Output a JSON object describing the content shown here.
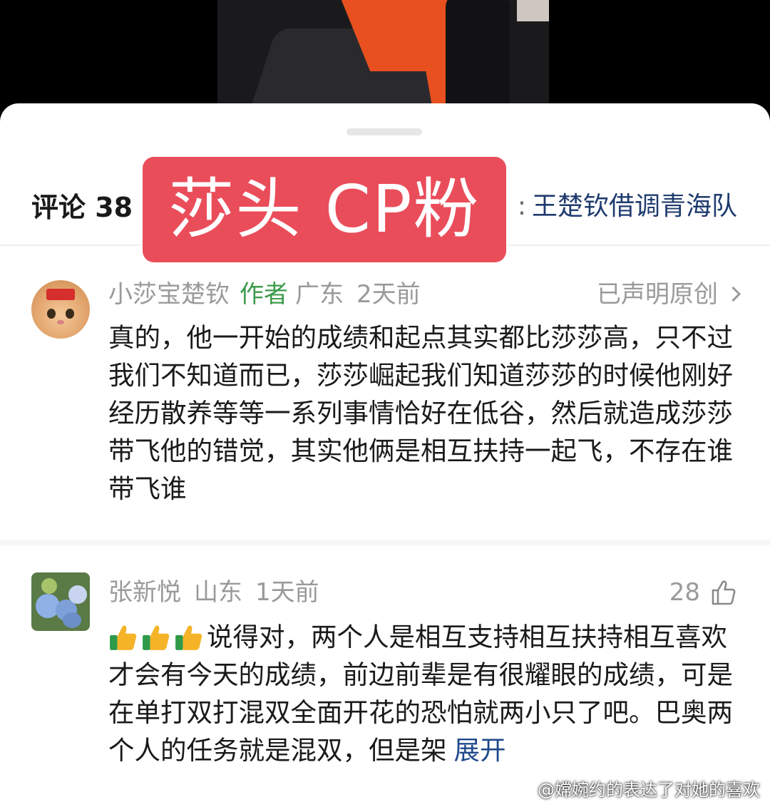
{
  "header": {
    "comments_label": "评论 38",
    "colon": ":",
    "topic": "王楚钦借调青海队"
  },
  "overlay": {
    "text": "莎头 CP粉"
  },
  "comments": [
    {
      "user": "小莎宝楚钦",
      "author_tag": "作者",
      "location": "广东",
      "time": "2天前",
      "right_label": "已声明原创",
      "text": "真的，他一开始的成绩和起点其实都比莎莎高，只不过我们不知道而已，莎莎崛起我们知道莎莎的时候他刚好经历散养等等一系列事情恰好在低谷，然后就造成莎莎带飞他的错觉，其实他俩是相互扶持一起飞，不存在谁带飞谁"
    },
    {
      "user": "张新悦",
      "location": "山东",
      "time": "1天前",
      "likes": "28",
      "text": "说得对，两个人是相互支持相互扶持相互喜欢才会有今天的成绩，前边前辈是有很耀眼的成绩，可是在单打双打混双全面开花的恐怕就两小只了吧。巴奥两个人的任务就是混双，但是架",
      "expand": "展开"
    }
  ],
  "watermark": "@嫦婉约的表达了对她的喜欢"
}
